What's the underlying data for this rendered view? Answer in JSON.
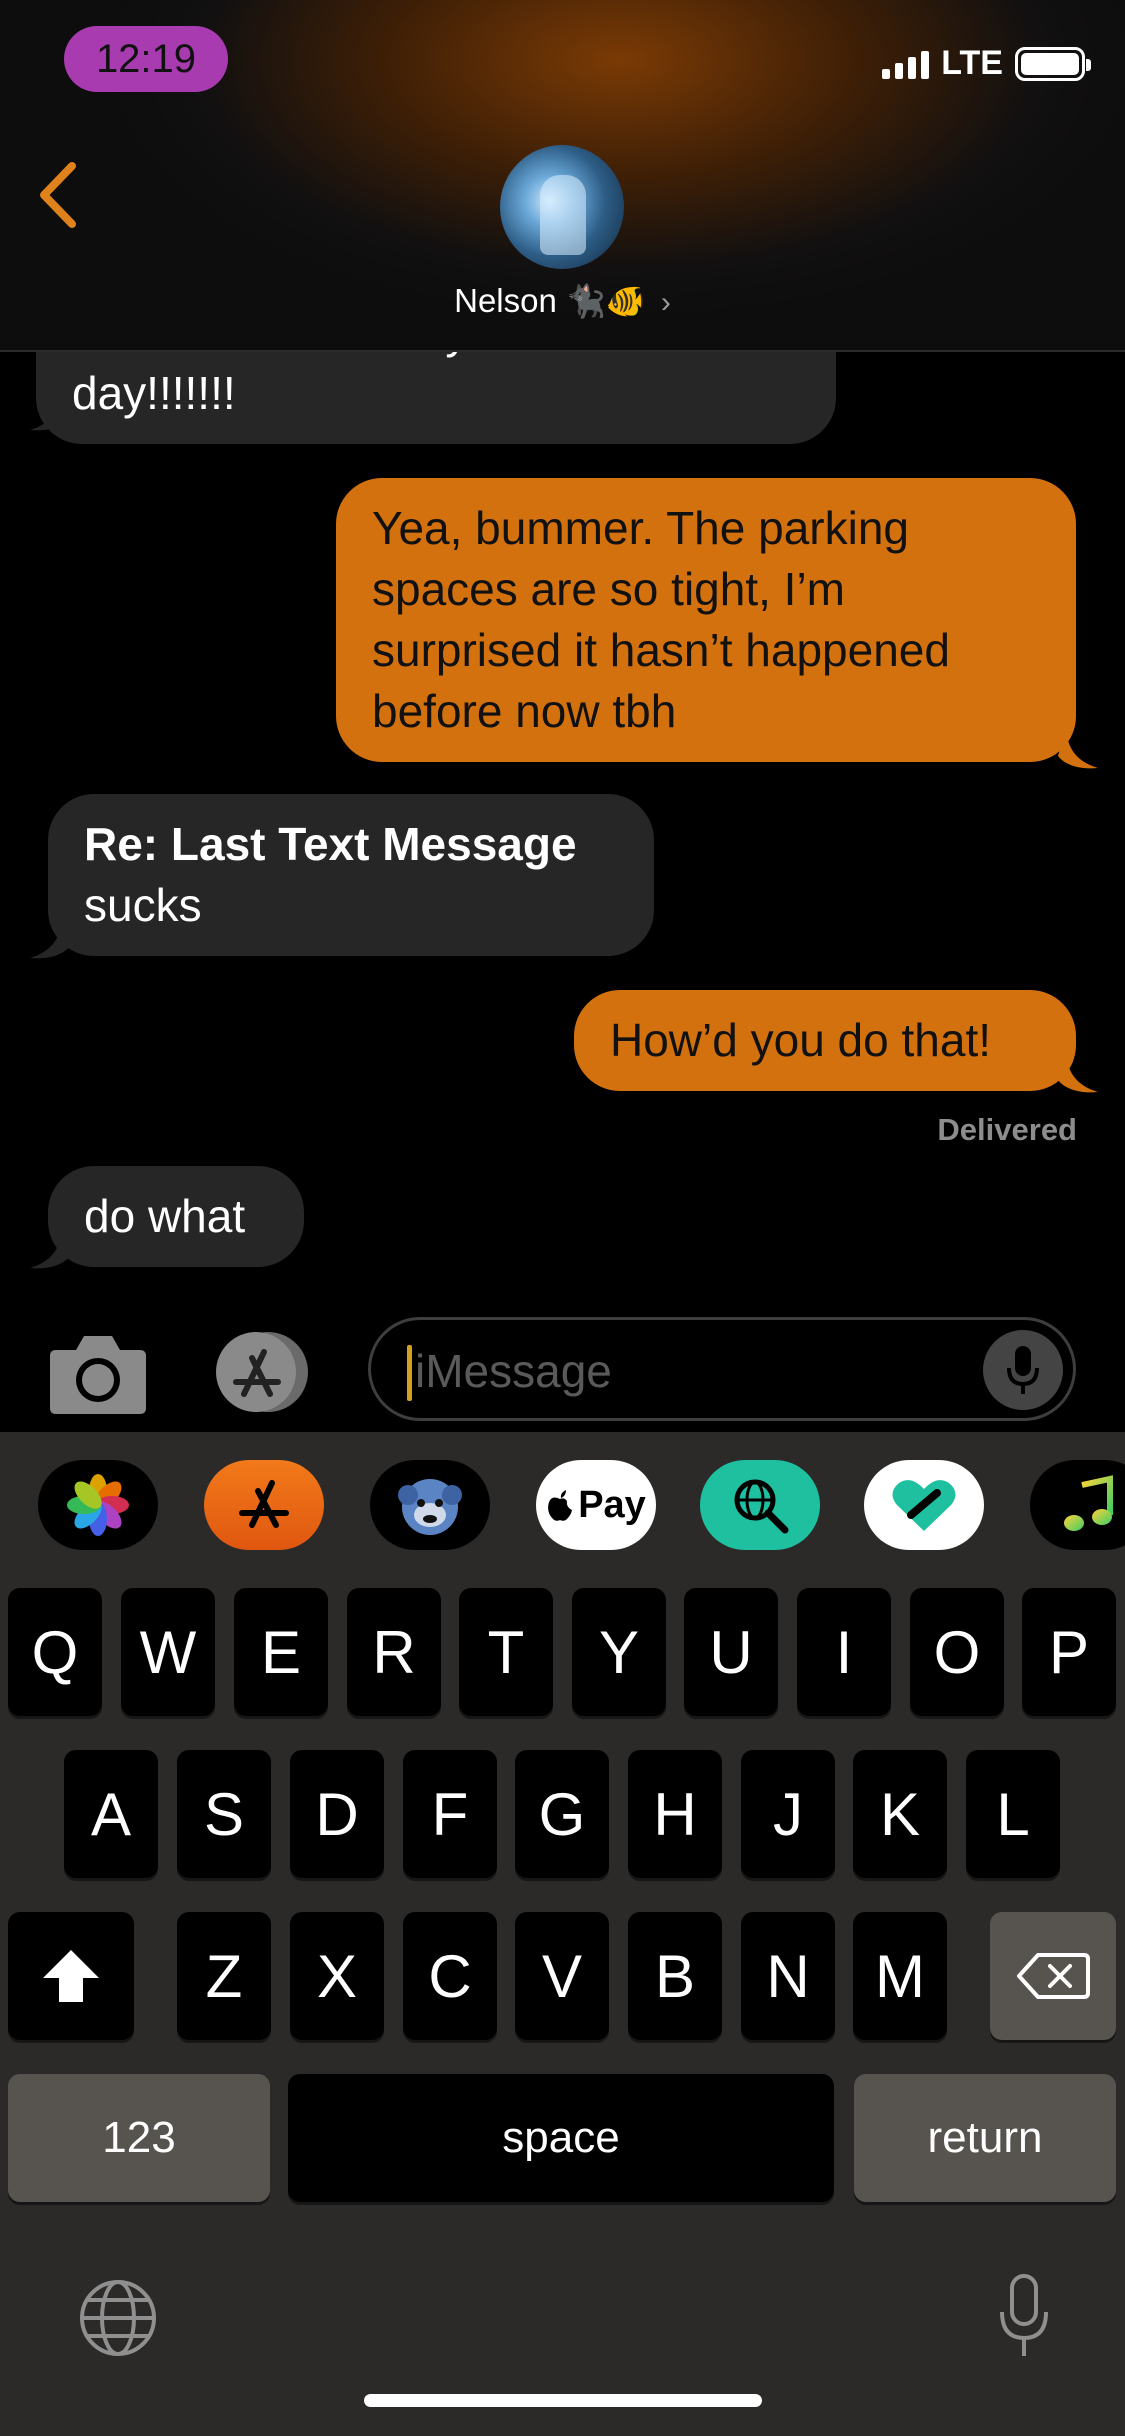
{
  "status_bar": {
    "time": "12:19",
    "network": "LTE"
  },
  "header": {
    "contact_name": "Nelson",
    "contact_emoji": "🐈‍⬛🐠",
    "chevron": "›"
  },
  "messages": [
    {
      "direction": "in",
      "lines": [
        "hahaha what a way to start the",
        "day!!!!!!!"
      ]
    },
    {
      "direction": "out",
      "lines": [
        "Yea, bummer. The parking",
        "spaces are so tight, I’m",
        "surprised it hasn’t happened",
        "before now tbh"
      ]
    },
    {
      "direction": "in",
      "title": "Re: Last Text Message",
      "body": "sucks"
    },
    {
      "direction": "out",
      "lines": [
        "How’d you do that!"
      ]
    },
    {
      "direction": "in",
      "lines": [
        "do what"
      ]
    }
  ],
  "delivered_label": "Delivered",
  "input": {
    "placeholder": "iMessage"
  },
  "app_drawer": [
    {
      "name": "Photos"
    },
    {
      "name": "App Store"
    },
    {
      "name": "Memoji"
    },
    {
      "name": "Apple Pay",
      "label": "Pay"
    },
    {
      "name": "Search Images"
    },
    {
      "name": "Digital Touch"
    },
    {
      "name": "Music"
    }
  ],
  "keyboard": {
    "row1": [
      "Q",
      "W",
      "E",
      "R",
      "T",
      "Y",
      "U",
      "I",
      "O",
      "P"
    ],
    "row2": [
      "A",
      "S",
      "D",
      "F",
      "G",
      "H",
      "J",
      "K",
      "L"
    ],
    "row3": [
      "Z",
      "X",
      "C",
      "V",
      "B",
      "N",
      "M"
    ],
    "numbers_label": "123",
    "space_label": "space",
    "return_label": "return"
  },
  "colors": {
    "accent": "#d4710f",
    "incoming_bubble": "#262626",
    "time_pill": "#a83bb0",
    "keyboard_bg": "#2b2a28"
  }
}
